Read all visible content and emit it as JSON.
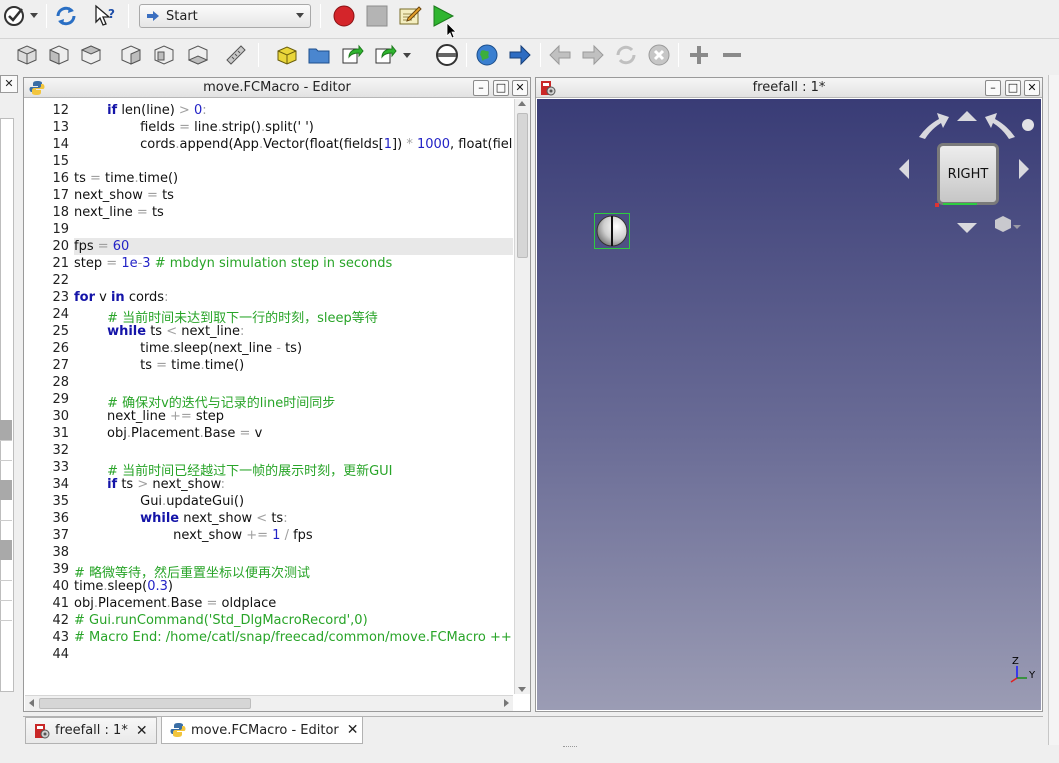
{
  "toolbar_top": {
    "macro_combo_value": "Start"
  },
  "editor": {
    "title": "move.FCMacro - Editor",
    "lines": [
      {
        "n": "12",
        "html": "        <span class='kw'>if</span> len(line) <span class='op'>&gt;</span> <span class='num'>0</span><span class='op'>:</span>"
      },
      {
        "n": "13",
        "html": "                fields <span class='op'>=</span> line<span class='op'>.</span>strip()<span class='op'>.</span>split(' ')"
      },
      {
        "n": "14",
        "html": "                cords<span class='op'>.</span>append(App<span class='op'>.</span>Vector(float(fields[<span class='num'>1</span>]) <span class='op'>*</span> <span class='num'>1000</span>, float(fiel"
      },
      {
        "n": "15",
        "html": ""
      },
      {
        "n": "16",
        "html": "ts <span class='op'>=</span> time<span class='op'>.</span>time()"
      },
      {
        "n": "17",
        "html": "next_show <span class='op'>=</span> ts"
      },
      {
        "n": "18",
        "html": "next_line <span class='op'>=</span> ts"
      },
      {
        "n": "19",
        "html": ""
      },
      {
        "n": "20",
        "html": "fps <span class='op'>=</span> <span class='num'>60</span>"
      },
      {
        "n": "21",
        "html": "step <span class='op'>=</span> <span class='num'>1e</span><span class='op'>-</span><span class='num'>3</span> <span class='cm'># mbdyn simulation step in seconds</span>"
      },
      {
        "n": "22",
        "html": ""
      },
      {
        "n": "23",
        "html": "<span class='kw'>for</span> v <span class='kw'>in</span> cords<span class='op'>:</span>"
      },
      {
        "n": "24",
        "html": "        <span class='cm'># 当前时间未达到取下一行的时刻，sleep等待</span>"
      },
      {
        "n": "25",
        "html": "        <span class='kw'>while</span> ts <span class='op'>&lt;</span> next_line<span class='op'>:</span>"
      },
      {
        "n": "26",
        "html": "                time<span class='op'>.</span>sleep(next_line <span class='op'>-</span> ts)"
      },
      {
        "n": "27",
        "html": "                ts <span class='op'>=</span> time<span class='op'>.</span>time()"
      },
      {
        "n": "28",
        "html": ""
      },
      {
        "n": "29",
        "html": "        <span class='cm'># 确保对v的迭代与记录的line时间同步</span>"
      },
      {
        "n": "30",
        "html": "        next_line <span class='op'>+=</span> step"
      },
      {
        "n": "31",
        "html": "        obj<span class='op'>.</span>Placement<span class='op'>.</span>Base <span class='op'>=</span> v"
      },
      {
        "n": "32",
        "html": ""
      },
      {
        "n": "33",
        "html": "        <span class='cm'># 当前时间已经越过下一帧的展示时刻，更新GUI</span>"
      },
      {
        "n": "34",
        "html": "        <span class='kw'>if</span> ts <span class='op'>&gt;</span> next_show<span class='op'>:</span>"
      },
      {
        "n": "35",
        "html": "                Gui<span class='op'>.</span>updateGui()"
      },
      {
        "n": "36",
        "html": "                <span class='kw'>while</span> next_show <span class='op'>&lt;</span> ts<span class='op'>:</span>"
      },
      {
        "n": "37",
        "html": "                        next_show <span class='op'>+=</span> <span class='num'>1</span> <span class='op'>/</span> fps"
      },
      {
        "n": "38",
        "html": ""
      },
      {
        "n": "39",
        "html": "<span class='cm'># 略微等待，然后重置坐标以便再次测试</span>"
      },
      {
        "n": "40",
        "html": "time<span class='op'>.</span>sleep(<span class='num'>0.3</span>)"
      },
      {
        "n": "41",
        "html": "obj<span class='op'>.</span>Placement<span class='op'>.</span>Base <span class='op'>=</span> oldplace"
      },
      {
        "n": "42",
        "html": "<span class='cm'># Gui.runCommand('Std_DlgMacroRecord',0)</span>"
      },
      {
        "n": "43",
        "html": "<span class='cm'># Macro End: /home/catl/snap/freecad/common/move.FCMacro ++</span>"
      },
      {
        "n": "44",
        "html": ""
      }
    ],
    "highlighted_line": "20"
  },
  "view3d": {
    "title": "freefall : 1*",
    "navcube_face": "RIGHT",
    "axis_z": "Z",
    "axis_y": "Y"
  },
  "tabs": [
    {
      "label": "freefall : 1*"
    },
    {
      "label": "move.FCMacro - Editor"
    }
  ],
  "colors": {
    "play_green": "#2fb52f",
    "record_red": "#d4252a",
    "comment_green": "#28a428",
    "keyword_blue": "#1414a8"
  }
}
